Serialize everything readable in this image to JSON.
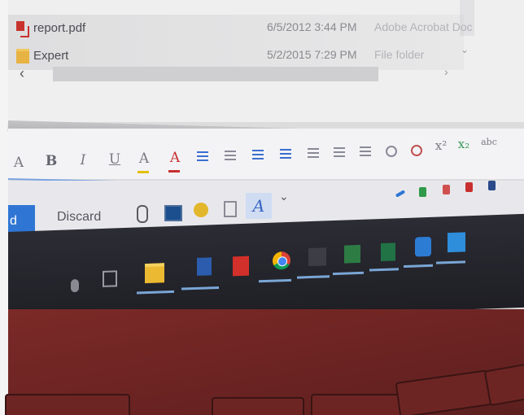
{
  "explorer": {
    "files": [
      {
        "name": "report.pdf",
        "date": "6/5/2012 3:44 PM",
        "type": "Adobe Acrobat Doc",
        "icon": "pdf-file-icon"
      },
      {
        "name": "Expert",
        "date": "5/2/2015 7:29 PM",
        "type": "File folder",
        "icon": "folder-icon"
      }
    ],
    "scroll_left_arrow": "‹",
    "scroll_right_arrow": "›",
    "chevron": "⌄"
  },
  "format_toolbar": {
    "buttons": [
      {
        "name": "font-size-button",
        "label": "A"
      },
      {
        "name": "bold-button",
        "label": "B"
      },
      {
        "name": "italic-button",
        "label": "I"
      },
      {
        "name": "underline-button",
        "label": "U"
      },
      {
        "name": "highlight-button",
        "label": "A"
      },
      {
        "name": "font-color-button",
        "label": "A"
      }
    ]
  },
  "compose_bar": {
    "send_label": "d",
    "discard_label": "Discard",
    "spelling_label": "A",
    "more_label": "⌄"
  },
  "colors": {
    "send_blue": "#2f76d4",
    "taskbar": "#24242b",
    "laptop_red": "#6a2322",
    "accent_line": "#7aa3e0"
  }
}
